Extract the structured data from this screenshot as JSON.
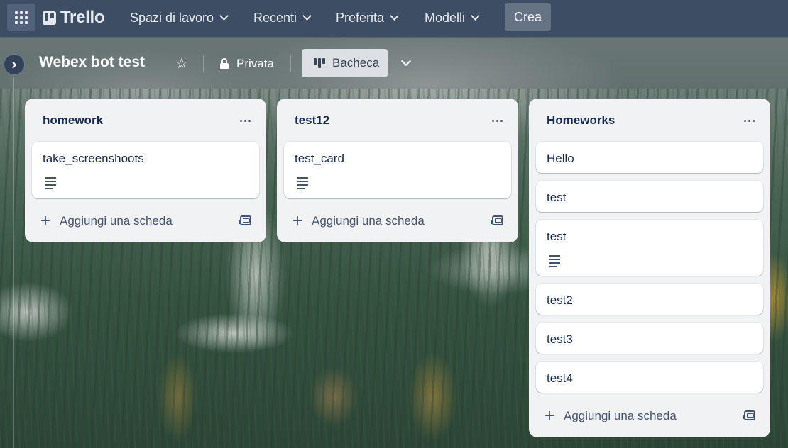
{
  "topnav": {
    "logo": "Trello",
    "items": [
      {
        "label": "Spazi di lavoro"
      },
      {
        "label": "Recenti"
      },
      {
        "label": "Preferita"
      },
      {
        "label": "Modelli"
      }
    ],
    "create_label": "Crea"
  },
  "board": {
    "title": "Webex bot test",
    "visibility": "Privata",
    "view": "Bacheca"
  },
  "lists": [
    {
      "title": "homework",
      "cards": [
        {
          "title": "take_screenshoots",
          "has_description": true
        }
      ],
      "add_card_label": "Aggiungi una scheda"
    },
    {
      "title": "test12",
      "cards": [
        {
          "title": "test_card",
          "has_description": true
        }
      ],
      "add_card_label": "Aggiungi una scheda"
    },
    {
      "title": "Homeworks",
      "cards": [
        {
          "title": "Hello",
          "has_description": false
        },
        {
          "title": "test",
          "has_description": false
        },
        {
          "title": "test",
          "has_description": true
        },
        {
          "title": "test2",
          "has_description": false
        },
        {
          "title": "test3",
          "has_description": false
        },
        {
          "title": "test4",
          "has_description": false
        }
      ],
      "add_card_label": "Aggiungi una scheda"
    }
  ],
  "colors": {
    "nav_bg": "#3d4d64",
    "list_bg": "#f1f2f4",
    "card_bg": "#ffffff",
    "text_primary": "#172b4d"
  },
  "icons": [
    "apps-grid-icon",
    "trello-logo-icon",
    "chevron-down-icon",
    "star-icon",
    "lock-icon",
    "board-icon",
    "more-icon",
    "description-icon",
    "plus-icon",
    "template-icon",
    "sidebar-toggle-icon"
  ]
}
